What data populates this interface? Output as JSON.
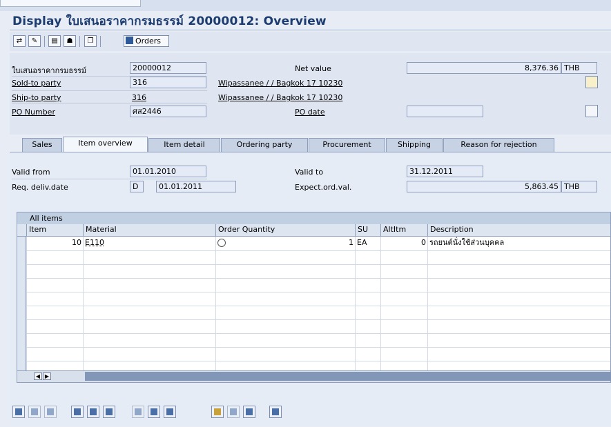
{
  "title": "Display ใบเสนอราคากรมธรรม์ 20000012: Overview",
  "toolbar": {
    "icons": [
      "display-change-icon",
      "create-icon",
      "header-detail-icon",
      "partner-icon",
      "copy-icon"
    ],
    "orders_label": "Orders"
  },
  "header": {
    "quotation_label": "ใบเสนอราคากรมธรรม์",
    "quotation_value": "20000012",
    "net_value_label": "Net value",
    "net_value": "8,376.36",
    "currency": "THB",
    "sold_to_label": "Sold-to party",
    "sold_to_value": "316",
    "sold_to_name": "Wipassanee / / Bagkok 17 10230",
    "ship_to_label": "Ship-to party",
    "ship_to_value": "316",
    "ship_to_name": "Wipassanee / / Bagkok 17 10230",
    "po_number_label": "PO Number",
    "po_number_value": "ศส2446",
    "po_date_label": "PO date",
    "po_date_value": ""
  },
  "tabs": [
    "Sales",
    "Item overview",
    "Item detail",
    "Ordering party",
    "Procurement",
    "Shipping",
    "Reason for rejection"
  ],
  "active_tab": "Item overview",
  "overview": {
    "valid_from_label": "Valid from",
    "valid_from": "01.01.2010",
    "valid_to_label": "Valid to",
    "valid_to": "31.12.2011",
    "req_deliv_label": "Req. deliv.date",
    "req_deliv_type": "D",
    "req_deliv_date": "01.01.2011",
    "expect_label": "Expect.ord.val.",
    "expect_value": "5,863.45",
    "expect_currency": "THB"
  },
  "grid": {
    "title": "All items",
    "columns": [
      "Item",
      "Material",
      "Order Quantity",
      "SU",
      "AltItm",
      "Description"
    ],
    "rows": [
      {
        "item": "10",
        "material": "E110",
        "quantity": "1",
        "su": "EA",
        "altitm": "0",
        "description": "รถยนต์นั่งใช้ส่วนบุคคล"
      }
    ]
  },
  "bottom_icons": [
    "detail-icon",
    "create-item-icon",
    "delete-item-icon",
    "select-all-icon",
    "deselect-all-icon",
    "select-block-icon",
    "copy-item-icon",
    "configure-icon",
    "pricing-icon",
    "availability-icon",
    "item-detail-icon",
    "edit-icon",
    "print-icon"
  ]
}
